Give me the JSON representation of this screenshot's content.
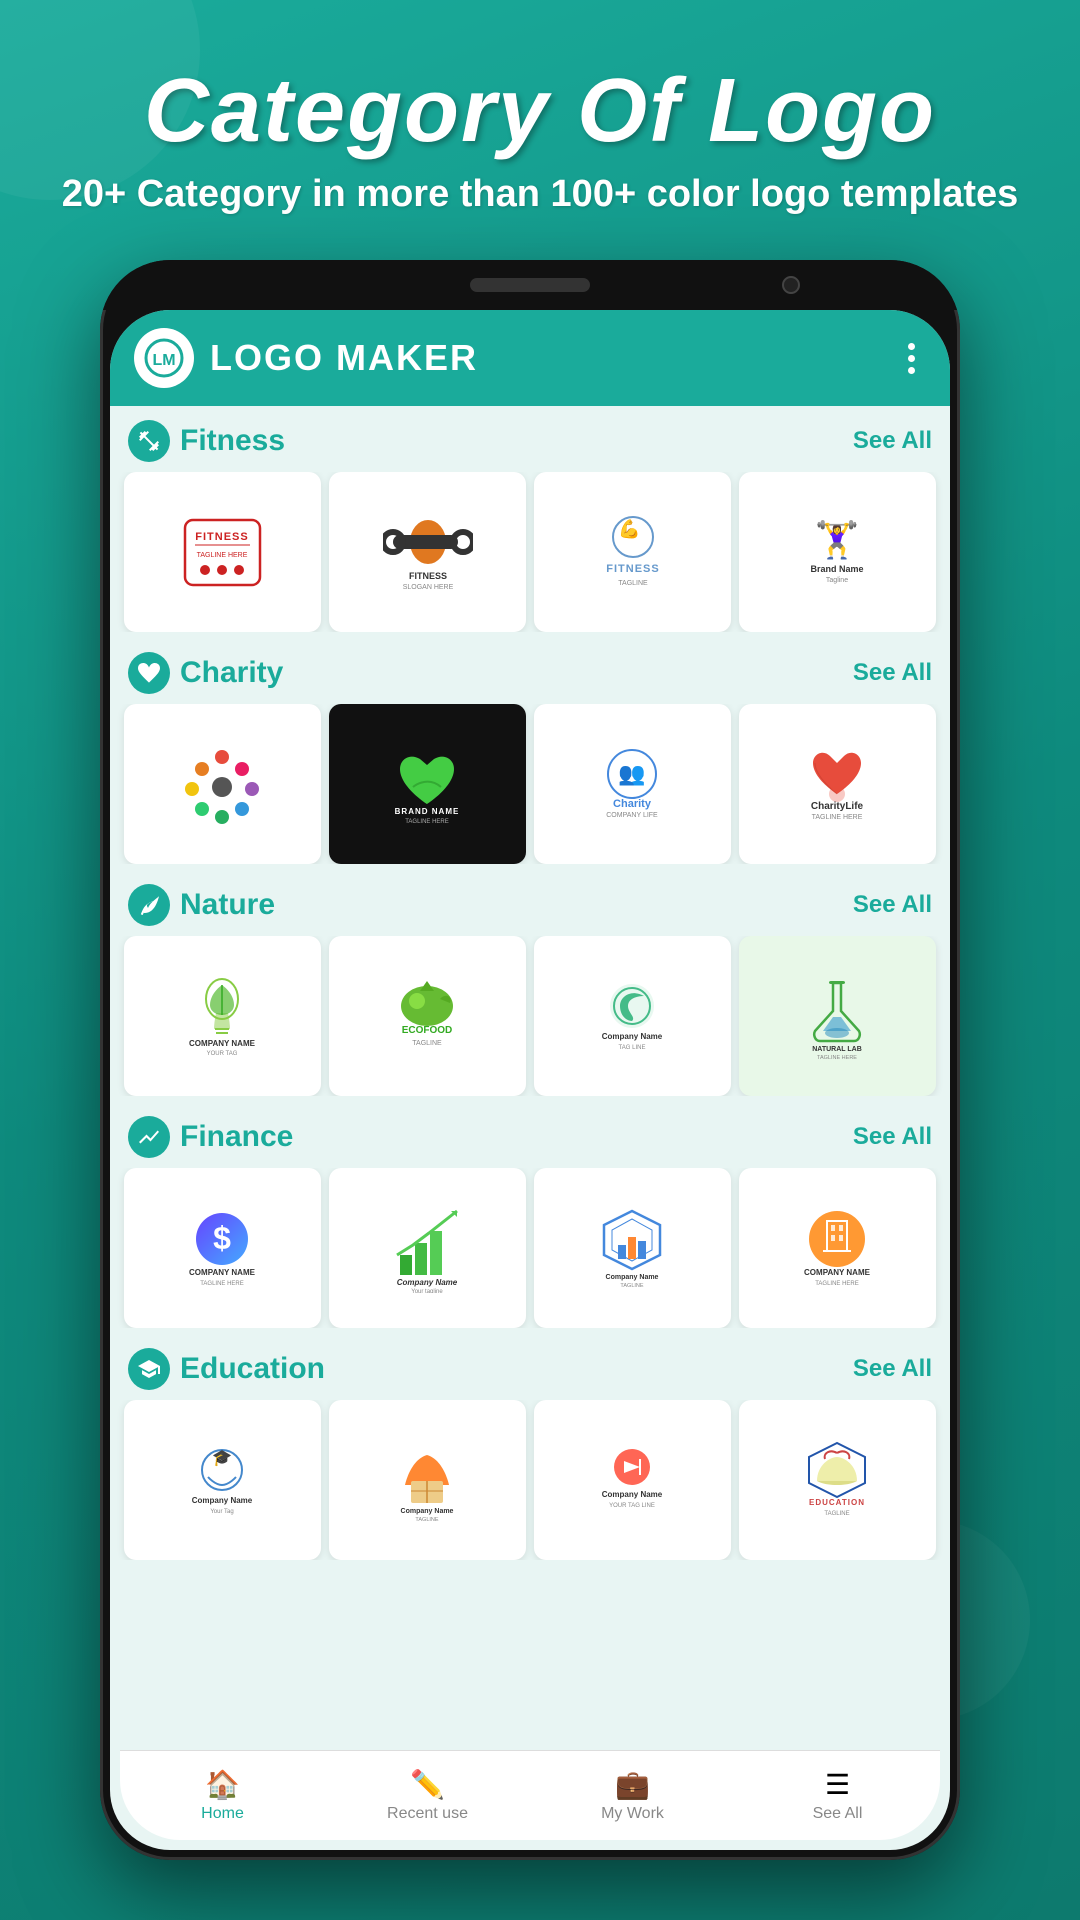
{
  "header": {
    "title": "Category Of Logo",
    "subtitle": "20+ Category in more than 100+ color logo templates"
  },
  "app": {
    "header": {
      "logo_text": "LM",
      "title": "LOGO MAKER"
    }
  },
  "categories": [
    {
      "id": "fitness",
      "title": "Fitness",
      "see_all": "See All",
      "icon": "🏋️"
    },
    {
      "id": "charity",
      "title": "Charity",
      "see_all": "See All",
      "icon": "🤝"
    },
    {
      "id": "nature",
      "title": "Nature",
      "see_all": "See All",
      "icon": "🌿"
    },
    {
      "id": "finance",
      "title": "Finance",
      "see_all": "See All",
      "icon": "📊"
    },
    {
      "id": "education",
      "title": "Education",
      "see_all": "See All",
      "icon": "🎓"
    }
  ],
  "nav": {
    "items": [
      {
        "id": "home",
        "label": "Home",
        "icon": "🏠",
        "active": true
      },
      {
        "id": "recent",
        "label": "Recent use",
        "icon": "✏️",
        "active": false
      },
      {
        "id": "mywork",
        "label": "My Work",
        "icon": "💼",
        "active": false
      },
      {
        "id": "seeall",
        "label": "See All",
        "icon": "☰",
        "active": false
      }
    ]
  }
}
